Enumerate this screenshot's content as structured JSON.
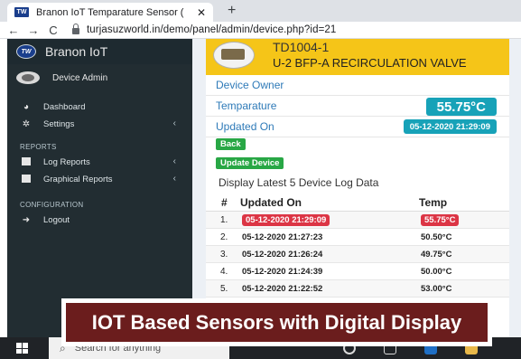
{
  "browser": {
    "tab_title": "Branon IoT Temparature Sensor (",
    "tab_close": "✕",
    "new_tab": "+",
    "back": "←",
    "forward": "→",
    "reload": "C",
    "url": "turjasuzworld.in/demo/panel/admin/device.php?id=21"
  },
  "sidebar": {
    "brand": "Branon IoT",
    "user": "Device Admin",
    "items": [
      {
        "label": "Dashboard",
        "icon": "dashboard-icon"
      },
      {
        "label": "Settings",
        "icon": "gear-icon",
        "arrow": "‹"
      }
    ],
    "reports_header": "REPORTS",
    "reports": [
      {
        "label": "Log Reports",
        "icon": "folder-icon",
        "arrow": "‹"
      },
      {
        "label": "Graphical Reports",
        "icon": "folder-icon",
        "arrow": "‹"
      }
    ],
    "config_header": "CONFIGURATION",
    "config": [
      {
        "label": "Logout",
        "icon": "logout-icon"
      }
    ]
  },
  "device": {
    "id": "TD1004-1",
    "name": "U-2 BFP-A RECIRCULATION VALVE",
    "owner_label": "Device Owner",
    "temp_label": "Temparature",
    "temp_value": "55.75°C",
    "updated_label": "Updated On",
    "updated_value": "05-12-2020 21:29:09",
    "back_button": "Back",
    "update_button": "Update Device"
  },
  "log": {
    "title": "Display Latest 5 Device Log Data",
    "col_no": "#",
    "col_updated": "Updated On",
    "col_temp": "Temp",
    "rows": [
      {
        "no": "1.",
        "date": "05-12-2020 21:29:09",
        "temp": "55.75°C",
        "highlight": true
      },
      {
        "no": "2.",
        "date": "05-12-2020 21:27:23",
        "temp": "50.50°C"
      },
      {
        "no": "3.",
        "date": "05-12-2020 21:26:24",
        "temp": "49.75°C"
      },
      {
        "no": "4.",
        "date": "05-12-2020 21:24:39",
        "temp": "50.00°C"
      },
      {
        "no": "5.",
        "date": "05-12-2020 21:22:52",
        "temp": "53.00°C"
      }
    ]
  },
  "banner": {
    "text": "IOT Based Sensors with Digital Display"
  },
  "taskbar": {
    "search_placeholder": "Search for anything"
  },
  "colors": {
    "sidebar_bg": "#222d32",
    "header_yellow": "#f5c518",
    "info_teal": "#17a2b8",
    "success_green": "#28a745",
    "danger_red": "#dc3545",
    "banner_maroon": "#6b1d1d"
  }
}
